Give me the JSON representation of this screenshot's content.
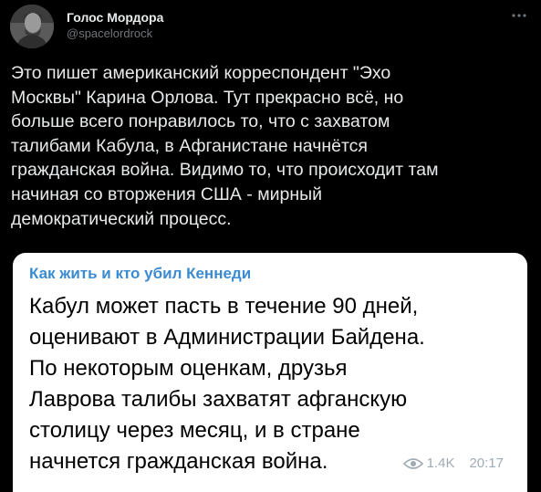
{
  "author": {
    "display_name": "Голос Мордора",
    "handle": "@spacelordrock"
  },
  "icons": {
    "more": "more-horizontal-icon",
    "views": "eye-icon"
  },
  "tweet": {
    "text": "Это пишет американский корреспондент \"Эхо\nМосквы\" Карина Орлова. Тут прекрасно всё, но\nбольше всего понравилось то, что с захватом\nталибами Кабула, в Афганистане начнётся\nгражданская война. Видимо то, что происходит там\nначиная со вторжения США - мирный\nдемократический процесс."
  },
  "quoted_post": {
    "channel": "Как жить и кто убил Кеннеди",
    "text": "Кабул может пасть в течение 90 дней,\nоценивают в Администрации Байдена.\nПо некоторым оценкам, друзья\nЛаврова талибы захватят афганскую\nстолицу через месяц, и в стране\nначнется гражданская война.",
    "views": "1.4K",
    "time": "20:17"
  },
  "colors": {
    "background": "#000000",
    "primary_text": "#e7e9ea",
    "secondary_text": "#71767b",
    "channel_name": "#3a8bd1",
    "card_background": "#ffffff",
    "card_meta": "#a0acb5"
  }
}
